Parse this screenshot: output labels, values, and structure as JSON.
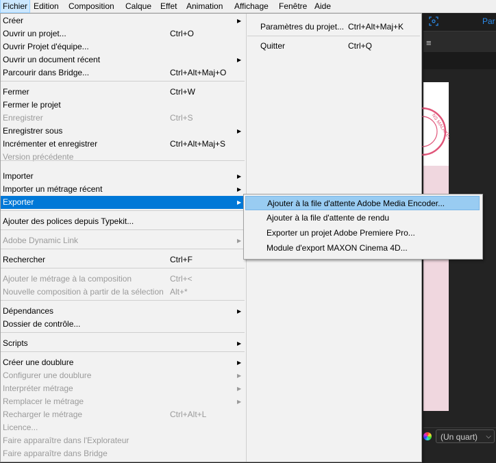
{
  "menubar": {
    "items": [
      "Fichier",
      "Edition",
      "Composition",
      "Calque",
      "Effet",
      "Animation",
      "Affichage",
      "Fenêtre",
      "Aide"
    ],
    "active_index": 0
  },
  "file_menu": {
    "items": [
      {
        "label": "Créer",
        "shortcut": "",
        "submenu": true,
        "enabled": true
      },
      {
        "label": "Ouvrir un projet...",
        "shortcut": "Ctrl+O",
        "submenu": false,
        "enabled": true
      },
      {
        "label": "Ouvrir Projet d'équipe...",
        "shortcut": "",
        "submenu": false,
        "enabled": true
      },
      {
        "label": "Ouvrir un document récent",
        "shortcut": "",
        "submenu": true,
        "enabled": true
      },
      {
        "label": "Parcourir dans Bridge...",
        "shortcut": "Ctrl+Alt+Maj+O",
        "submenu": false,
        "enabled": true
      },
      {
        "label": "Fermer",
        "shortcut": "Ctrl+W",
        "submenu": false,
        "enabled": true
      },
      {
        "label": "Fermer le projet",
        "shortcut": "",
        "submenu": false,
        "enabled": true
      },
      {
        "label": "Enregistrer",
        "shortcut": "Ctrl+S",
        "submenu": false,
        "enabled": false
      },
      {
        "label": "Enregistrer sous",
        "shortcut": "",
        "submenu": true,
        "enabled": true
      },
      {
        "label": "Incrémenter et enregistrer",
        "shortcut": "Ctrl+Alt+Maj+S",
        "submenu": false,
        "enabled": true
      },
      {
        "label": "Version précédente",
        "shortcut": "",
        "submenu": false,
        "enabled": false
      },
      {
        "label": "Importer",
        "shortcut": "",
        "submenu": true,
        "enabled": true
      },
      {
        "label": "Importer un métrage récent",
        "shortcut": "",
        "submenu": true,
        "enabled": true
      },
      {
        "label": "Exporter",
        "shortcut": "",
        "submenu": true,
        "enabled": true,
        "highlighted": true
      },
      {
        "label": "Ajouter des polices depuis Typekit...",
        "shortcut": "",
        "submenu": false,
        "enabled": true
      },
      {
        "label": "Adobe Dynamic Link",
        "shortcut": "",
        "submenu": true,
        "enabled": false
      },
      {
        "label": "Rechercher",
        "shortcut": "Ctrl+F",
        "submenu": false,
        "enabled": true
      },
      {
        "label": "Ajouter le métrage à la composition",
        "shortcut": "Ctrl+<",
        "submenu": false,
        "enabled": false
      },
      {
        "label": "Nouvelle composition à partir de la sélection",
        "shortcut": "Alt+*",
        "submenu": false,
        "enabled": false
      },
      {
        "label": "Dépendances",
        "shortcut": "",
        "submenu": true,
        "enabled": true
      },
      {
        "label": "Dossier de contrôle...",
        "shortcut": "",
        "submenu": false,
        "enabled": true
      },
      {
        "label": "Scripts",
        "shortcut": "",
        "submenu": true,
        "enabled": true
      },
      {
        "label": "Créer une doublure",
        "shortcut": "",
        "submenu": true,
        "enabled": true
      },
      {
        "label": "Configurer une doublure",
        "shortcut": "",
        "submenu": true,
        "enabled": false
      },
      {
        "label": "Interpréter métrage",
        "shortcut": "",
        "submenu": true,
        "enabled": false
      },
      {
        "label": "Remplacer le métrage",
        "shortcut": "",
        "submenu": true,
        "enabled": false
      },
      {
        "label": "Recharger le métrage",
        "shortcut": "Ctrl+Alt+L",
        "submenu": false,
        "enabled": false
      },
      {
        "label": "Licence...",
        "shortcut": "",
        "submenu": false,
        "enabled": false
      },
      {
        "label": "Faire apparaître dans l'Explorateur",
        "shortcut": "",
        "submenu": false,
        "enabled": false
      },
      {
        "label": "Faire apparaître dans Bridge",
        "shortcut": "",
        "submenu": false,
        "enabled": false
      }
    ]
  },
  "right_column": {
    "items": [
      {
        "label": "Paramètres du projet...",
        "shortcut": "Ctrl+Alt+Maj+K"
      },
      {
        "label": "Quitter",
        "shortcut": "Ctrl+Q"
      }
    ]
  },
  "export_submenu": {
    "items": [
      {
        "label": "Ajouter à la file d'attente Adobe Media Encoder...",
        "highlighted": true
      },
      {
        "label": "Ajouter à la file d'attente de rendu",
        "highlighted": false
      },
      {
        "label": "Exporter un projet Adobe Premiere Pro...",
        "highlighted": false
      },
      {
        "label": "Module d'export MAXON Cinema 4D...",
        "highlighted": false
      }
    ]
  },
  "background_app": {
    "panel_tab": "Par",
    "zoom_select": "(Un quart)"
  },
  "colors": {
    "menu_bg": "#f2f2f2",
    "highlight": "#0078d7",
    "submenu_highlight": "#99ccf2",
    "disabled_text": "#9a9a9a",
    "accent_blue": "#2d8ceb",
    "canvas_pink": "#f0d7df"
  }
}
